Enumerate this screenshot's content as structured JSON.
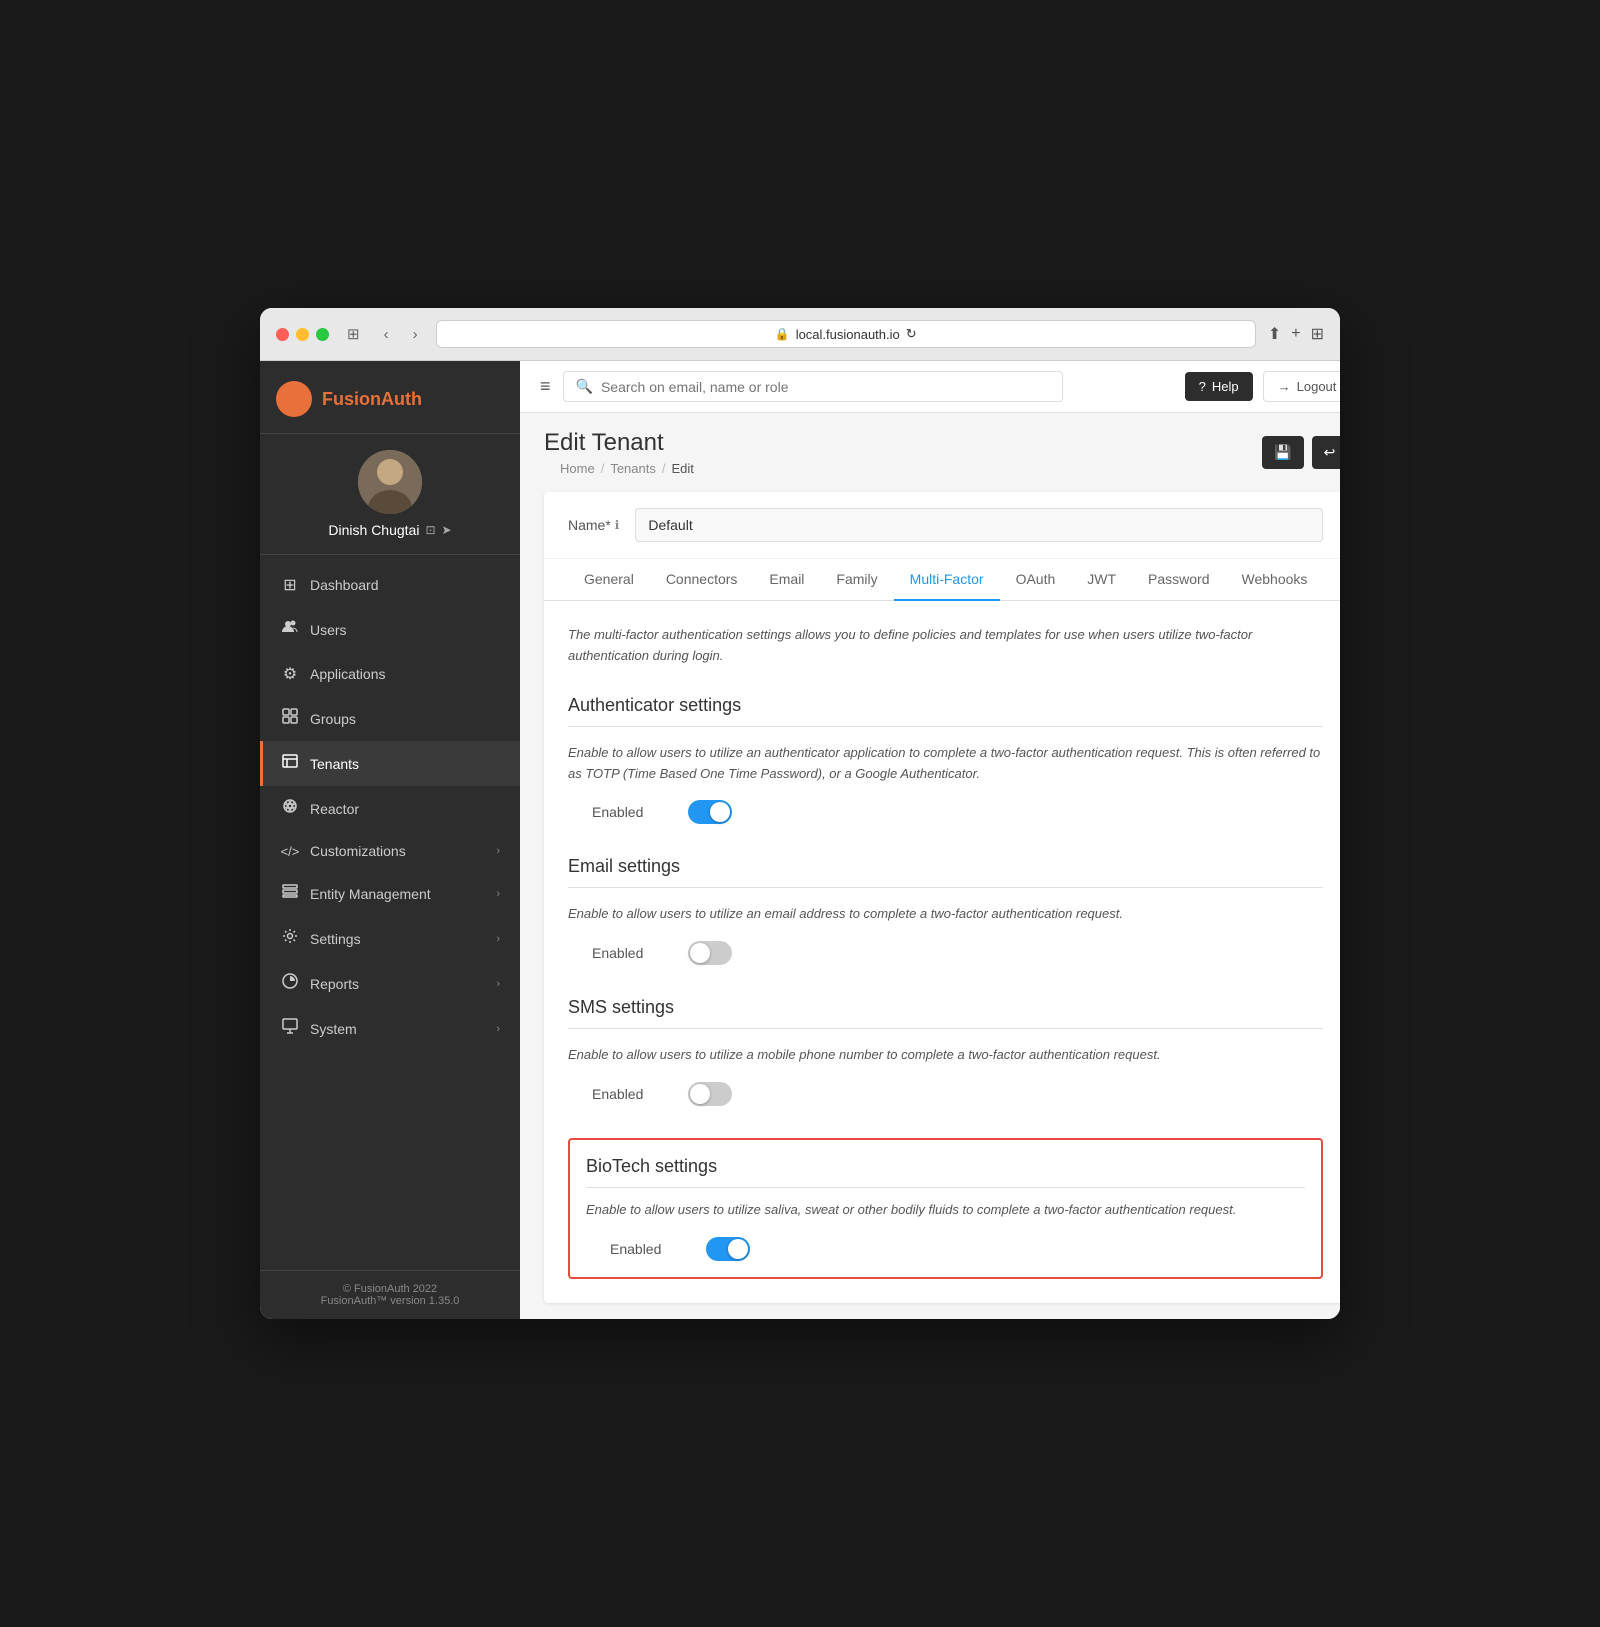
{
  "browser": {
    "url": "local.fusionauth.io",
    "refresh_icon": "↻"
  },
  "sidebar": {
    "brand": {
      "name_part1": "Fusion",
      "name_part2": "Auth"
    },
    "user": {
      "name": "Dinish Chugtai"
    },
    "nav_items": [
      {
        "id": "dashboard",
        "label": "Dashboard",
        "icon": "⊞",
        "active": false
      },
      {
        "id": "users",
        "label": "Users",
        "icon": "👥",
        "active": false
      },
      {
        "id": "applications",
        "label": "Applications",
        "icon": "⚙",
        "active": false
      },
      {
        "id": "groups",
        "label": "Groups",
        "icon": "⊡",
        "active": false
      },
      {
        "id": "tenants",
        "label": "Tenants",
        "icon": "📋",
        "active": true
      },
      {
        "id": "reactor",
        "label": "Reactor",
        "icon": "☢",
        "active": false
      },
      {
        "id": "customizations",
        "label": "Customizations",
        "icon": "</>",
        "active": false,
        "has_chevron": true
      },
      {
        "id": "entity-management",
        "label": "Entity Management",
        "icon": "⊟",
        "active": false,
        "has_chevron": true
      },
      {
        "id": "settings",
        "label": "Settings",
        "icon": "⚖",
        "active": false,
        "has_chevron": true
      },
      {
        "id": "reports",
        "label": "Reports",
        "icon": "📊",
        "active": false,
        "has_chevron": true
      },
      {
        "id": "system",
        "label": "System",
        "icon": "🖥",
        "active": false,
        "has_chevron": true
      }
    ],
    "footer": {
      "line1": "© FusionAuth 2022",
      "line2": "FusionAuth™ version 1.35.0"
    }
  },
  "topnav": {
    "search_placeholder": "Search on email, name or role",
    "help_label": "Help",
    "logout_label": "Logout"
  },
  "page": {
    "title": "Edit Tenant",
    "breadcrumbs": [
      "Home",
      "Tenants",
      "Edit"
    ],
    "name_label": "Name*",
    "name_value": "Default"
  },
  "tabs": {
    "items": [
      {
        "id": "general",
        "label": "General"
      },
      {
        "id": "connectors",
        "label": "Connectors"
      },
      {
        "id": "email",
        "label": "Email"
      },
      {
        "id": "family",
        "label": "Family"
      },
      {
        "id": "multi-factor",
        "label": "Multi-Factor",
        "active": true
      },
      {
        "id": "oauth",
        "label": "OAuth"
      },
      {
        "id": "jwt",
        "label": "JWT"
      },
      {
        "id": "password",
        "label": "Password"
      },
      {
        "id": "webhooks",
        "label": "Webhooks"
      }
    ]
  },
  "multifactor": {
    "intro": "The multi-factor authentication settings allows you to define policies and templates for use when users utilize two-factor authentication during login.",
    "authenticator": {
      "title": "Authenticator settings",
      "description": "Enable to allow users to utilize an authenticator application to complete a two-factor authentication request. This is often referred to as TOTP (Time Based One Time Password), or a Google Authenticator.",
      "enabled_label": "Enabled",
      "enabled": true
    },
    "email": {
      "title": "Email settings",
      "description": "Enable to allow users to utilize an email address to complete a two-factor authentication request.",
      "enabled_label": "Enabled",
      "enabled": false
    },
    "sms": {
      "title": "SMS settings",
      "description": "Enable to allow users to utilize a mobile phone number to complete a two-factor authentication request.",
      "enabled_label": "Enabled",
      "enabled": false
    },
    "biotech": {
      "title": "BioTech settings",
      "description": "Enable to allow users to utilize saliva, sweat or other bodily fluids to complete a two-factor authentication request.",
      "enabled_label": "Enabled",
      "enabled": true
    }
  }
}
